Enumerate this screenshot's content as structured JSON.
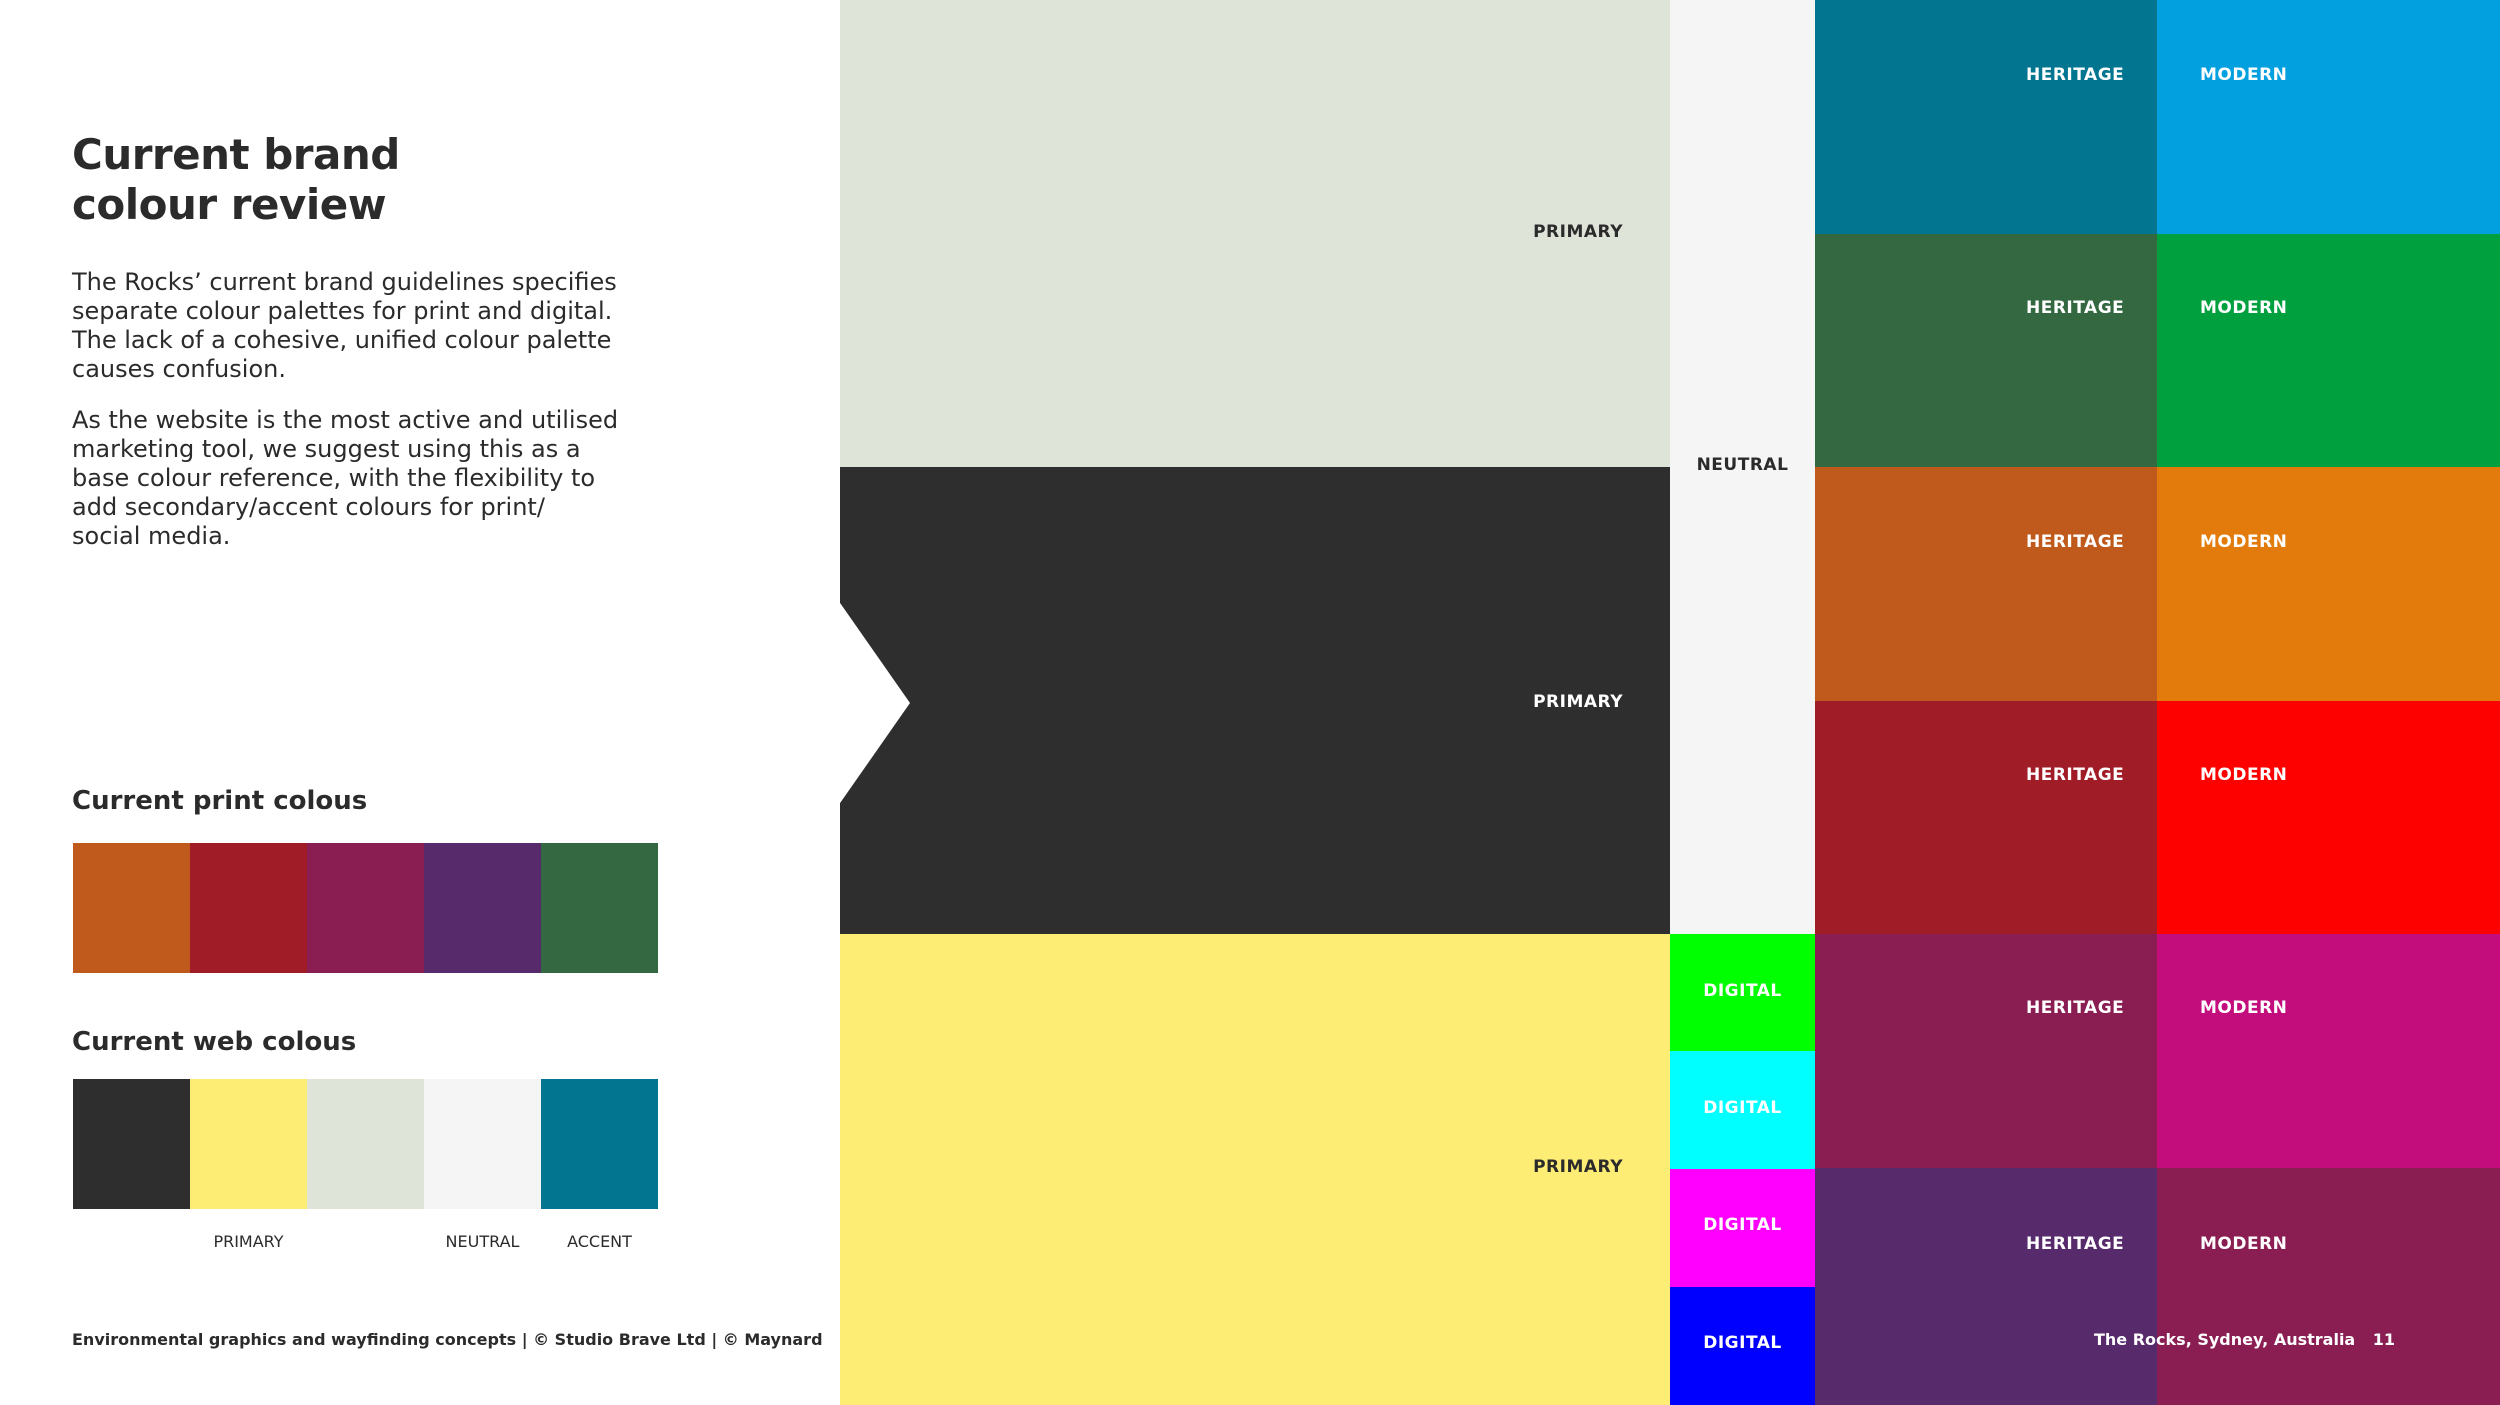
{
  "title": {
    "line1": "Current brand",
    "line2": "colour review"
  },
  "para1": {
    "l1": "The Rocks’ current brand guidelines specifies",
    "l2": "separate colour palettes for print and digital.",
    "l3": "The lack of a cohesive, unified colour palette",
    "l4": "causes confusion."
  },
  "para2": {
    "l1": "As the website is the most active and utilised",
    "l2": "marketing tool, we suggest using this as a",
    "l3": "base colour reference, with the flexibility to",
    "l4": "add secondary/accent colours for print/",
    "l5": "social media."
  },
  "print": {
    "heading": "Current print colous",
    "colors": [
      "#bf5a1c",
      "#a01c27",
      "#8a1d52",
      "#562a6b",
      "#336841"
    ]
  },
  "web": {
    "heading": "Current web colous",
    "colors": [
      "#2e2e2e",
      "#fded74",
      "#dfe4d9",
      "#f5f5f5",
      "#027590"
    ],
    "labels": {
      "primary": "PRIMARY",
      "neutral": "NEUTRAL",
      "accent": "ACCENT"
    }
  },
  "footer": {
    "left": "Environmental graphics and wayfinding concepts  | © Studio Brave Ltd |  © Maynard",
    "location": "The Rocks, Sydney, Australia",
    "page": "11"
  },
  "palette": {
    "primary": [
      {
        "label": "PRIMARY",
        "color": "#dfe4d9"
      },
      {
        "label": "PRIMARY",
        "color": "#2e2e2e"
      },
      {
        "label": "PRIMARY",
        "color": "#fded74"
      }
    ],
    "neutral": {
      "label": "NEUTRAL",
      "color": "#f5f5f5"
    },
    "digital": [
      {
        "label": "DIGITAL",
        "color": "#00ff00"
      },
      {
        "label": "DIGITAL",
        "color": "#00ffff"
      },
      {
        "label": "DIGITAL",
        "color": "#ff00ff"
      },
      {
        "label": "DIGITAL",
        "color": "#0000ff"
      }
    ],
    "pairs": [
      {
        "heritage": "HERITAGE",
        "heritage_color": "#027590",
        "modern": "MODERN",
        "modern_color": "#03a0df"
      },
      {
        "heritage": "HERITAGE",
        "heritage_color": "#336841",
        "modern": "MODERN",
        "modern_color": "#00a03f"
      },
      {
        "heritage": "HERITAGE",
        "heritage_color": "#bf5a1c",
        "modern": "MODERN",
        "modern_color": "#e27b0c"
      },
      {
        "heritage": "HERITAGE",
        "heritage_color": "#a01c27",
        "modern": "MODERN",
        "modern_color": "#fd0000"
      },
      {
        "heritage": "HERITAGE",
        "heritage_color": "#8a1d52",
        "modern": "MODERN",
        "modern_color": "#c30d7d"
      },
      {
        "heritage": "HERITAGE",
        "heritage_color": "#562a6b",
        "modern": "MODERN",
        "modern_color": "#8a1d52"
      }
    ]
  }
}
